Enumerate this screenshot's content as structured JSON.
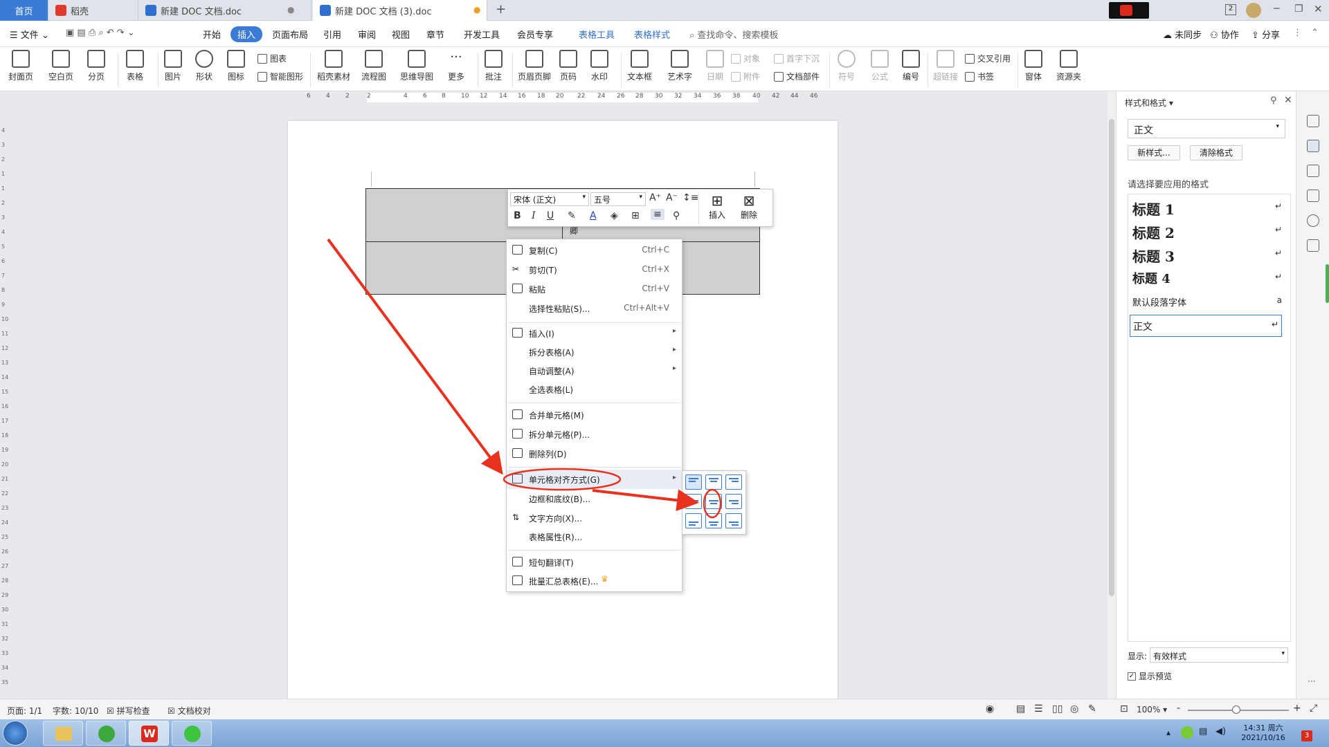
{
  "tabs": {
    "home": "首页",
    "tab1": "稻壳",
    "tab2": "新建 DOC 文档.doc",
    "tab3": "新建 DOC 文档 (3).doc",
    "add": "+"
  },
  "window": {
    "badge": "2"
  },
  "menubar": {
    "file": "文件",
    "items": [
      "开始",
      "插入",
      "页面布局",
      "引用",
      "审阅",
      "视图",
      "章节",
      "开发工具",
      "会员专享"
    ],
    "context_tabs": [
      "表格工具",
      "表格样式"
    ],
    "search_placeholder": "查找命令、搜索模板",
    "right": [
      "未同步",
      "协作",
      "分享"
    ]
  },
  "ribbon": {
    "big": [
      "封面页",
      "空白页",
      "分页",
      "表格",
      "图片",
      "形状",
      "图标",
      "稻壳素材",
      "流程图",
      "思维导图",
      "更多",
      "批注",
      "页眉页脚",
      "页码",
      "水印",
      "文本框",
      "艺术字",
      "日期",
      "超链接",
      "窗体",
      "资源夹"
    ],
    "small": [
      "图表",
      "智能图形",
      "对象",
      "附件",
      "首字下沉",
      "文档部件",
      "符号",
      "公式",
      "编号",
      "交叉引用",
      "书签"
    ]
  },
  "ruler": {
    "h": [
      "6",
      "4",
      "2",
      "2",
      "4",
      "6",
      "8",
      "10",
      "12",
      "14",
      "16",
      "18",
      "20",
      "22",
      "24",
      "26",
      "28",
      "30",
      "32",
      "34",
      "36",
      "38",
      "40",
      "42",
      "44",
      "46"
    ],
    "v": [
      "4",
      "3",
      "2",
      "1",
      "1",
      "2",
      "3",
      "4",
      "5",
      "6",
      "7",
      "8",
      "9",
      "10",
      "11",
      "12",
      "13",
      "14",
      "15",
      "16",
      "17",
      "18",
      "19",
      "20",
      "21",
      "22",
      "23",
      "24",
      "25",
      "26",
      "27",
      "28",
      "29",
      "30",
      "31",
      "32",
      "33",
      "34",
      "35"
    ]
  },
  "table": {
    "cell_text": "卿"
  },
  "minitoolbar": {
    "font": "宋体 (正文)",
    "size": "五号",
    "insert": "插入",
    "delete": "删除",
    "bold": "B",
    "italic": "I",
    "underline": "U"
  },
  "context_menu": {
    "items": [
      {
        "label": "复制(C)",
        "shortcut": "Ctrl+C"
      },
      {
        "label": "剪切(T)",
        "shortcut": "Ctrl+X"
      },
      {
        "label": "粘贴",
        "shortcut": "Ctrl+V"
      },
      {
        "label": "选择性粘贴(S)...",
        "shortcut": "Ctrl+Alt+V"
      },
      {
        "label": "插入(I)"
      },
      {
        "label": "拆分表格(A)"
      },
      {
        "label": "自动调整(A)"
      },
      {
        "label": "全选表格(L)"
      },
      {
        "label": "合并单元格(M)"
      },
      {
        "label": "拆分单元格(P)..."
      },
      {
        "label": "删除列(D)"
      },
      {
        "label": "单元格对齐方式(G)"
      },
      {
        "label": "边框和底纹(B)..."
      },
      {
        "label": "文字方向(X)..."
      },
      {
        "label": "表格属性(R)..."
      },
      {
        "label": "短句翻译(T)"
      },
      {
        "label": "批量汇总表格(E)..."
      }
    ]
  },
  "panel": {
    "title": "样式和格式",
    "current_style": "正文",
    "new_style": "新样式...",
    "clear_format": "清除格式",
    "prompt": "请选择要应用的格式",
    "styles": [
      "标题 1",
      "标题 2",
      "标题 3",
      "标题 4",
      "默认段落字体",
      "正文"
    ],
    "show_label": "显示:",
    "show_value": "有效样式",
    "preview": "显示预览"
  },
  "status": {
    "page": "页面: 1/1",
    "words": "字数: 10/10",
    "spell": "拼写检查",
    "proof": "文档校对",
    "zoom": "100%",
    "minus": "-",
    "plus": "+"
  },
  "taskbar": {
    "time": "14:31 周六",
    "date": "2021/10/16",
    "badge": "3"
  },
  "colors": {
    "accent": "#3a7bd5",
    "annotation": "#e8321e"
  }
}
